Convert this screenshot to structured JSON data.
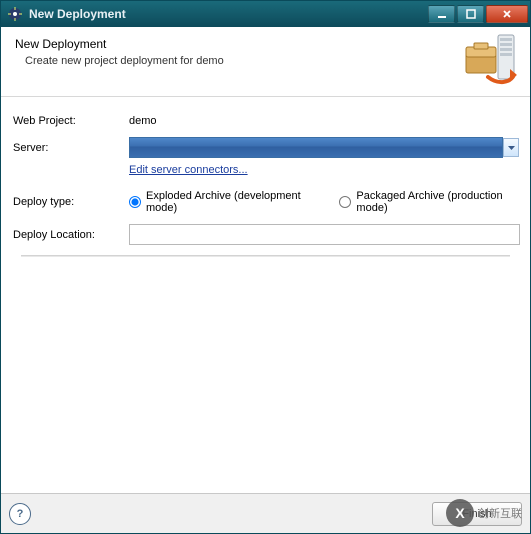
{
  "window": {
    "title": "New Deployment"
  },
  "header": {
    "title": "New Deployment",
    "subtitle": "Create new project deployment for demo"
  },
  "form": {
    "webProject": {
      "label": "Web Project:",
      "value": "demo"
    },
    "server": {
      "label": "Server:",
      "value": ""
    },
    "editLink": "Edit server connectors...",
    "deployType": {
      "label": "Deploy type:",
      "options": [
        {
          "label": "Exploded Archive (development mode)",
          "selected": true
        },
        {
          "label": "Packaged Archive (production mode)",
          "selected": false
        }
      ]
    },
    "deployLocation": {
      "label": "Deploy Location:",
      "value": ""
    }
  },
  "footer": {
    "finish": "Finish"
  },
  "watermark": {
    "text": "创新互联"
  }
}
